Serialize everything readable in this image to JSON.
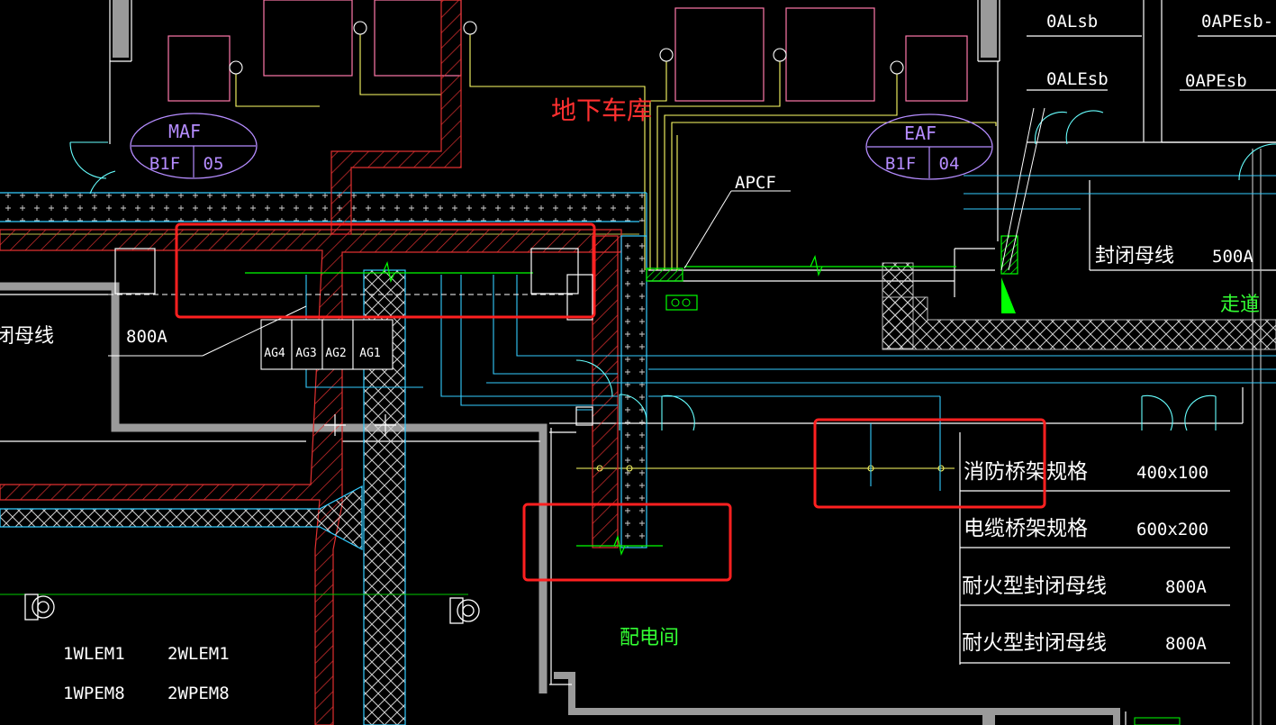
{
  "palette": {
    "bg": "#000000",
    "white": "#ffffff",
    "wall": "#9a9a9a",
    "yellow": "#ffff66",
    "cyan": "#33ccff",
    "cyanLight": "#66ffff",
    "green": "#00ff00",
    "red": "#ff3333",
    "redHatch": "#e03030",
    "magenta": "#ff77aa",
    "violet": "#b58cff",
    "highlight": "#ff2020",
    "labelRed": "#ff3030",
    "textWhite": "#ffffff",
    "textGreen": "#33ff33"
  },
  "title_label": "地下车库",
  "room_label": "配电间",
  "corridor_label": "走道",
  "apcf_label": "APCF",
  "rooms": {
    "maf": {
      "name": "MAF",
      "floor": "B1F",
      "num": "05"
    },
    "eaf": {
      "name": "EAF",
      "floor": "B1F",
      "num": "04"
    }
  },
  "panel_labels": {
    "oalsb": "0ALsb",
    "oapesb_minus": "0APEsb-",
    "alesb": "0ALEsb",
    "apesb": "0APEsb"
  },
  "busbar_top": {
    "label": "封闭母线",
    "rating": "500A"
  },
  "busbar_left": {
    "label": "闭母线",
    "rating": "800A"
  },
  "ag_boxes": [
    "AG4",
    "AG3",
    "AG2",
    "AG1"
  ],
  "legend_rows": [
    {
      "name": "消防桥架规格",
      "value": "400x100"
    },
    {
      "name": "电缆桥架规格",
      "value": "600x200"
    },
    {
      "name": "耐火型封闭母线",
      "value": "800A"
    },
    {
      "name": "耐火型封闭母线",
      "value": "800A"
    }
  ],
  "meter_labels": [
    "1WLEM1",
    "2WLEM1",
    "1WPEM8",
    "2WPEM8"
  ]
}
